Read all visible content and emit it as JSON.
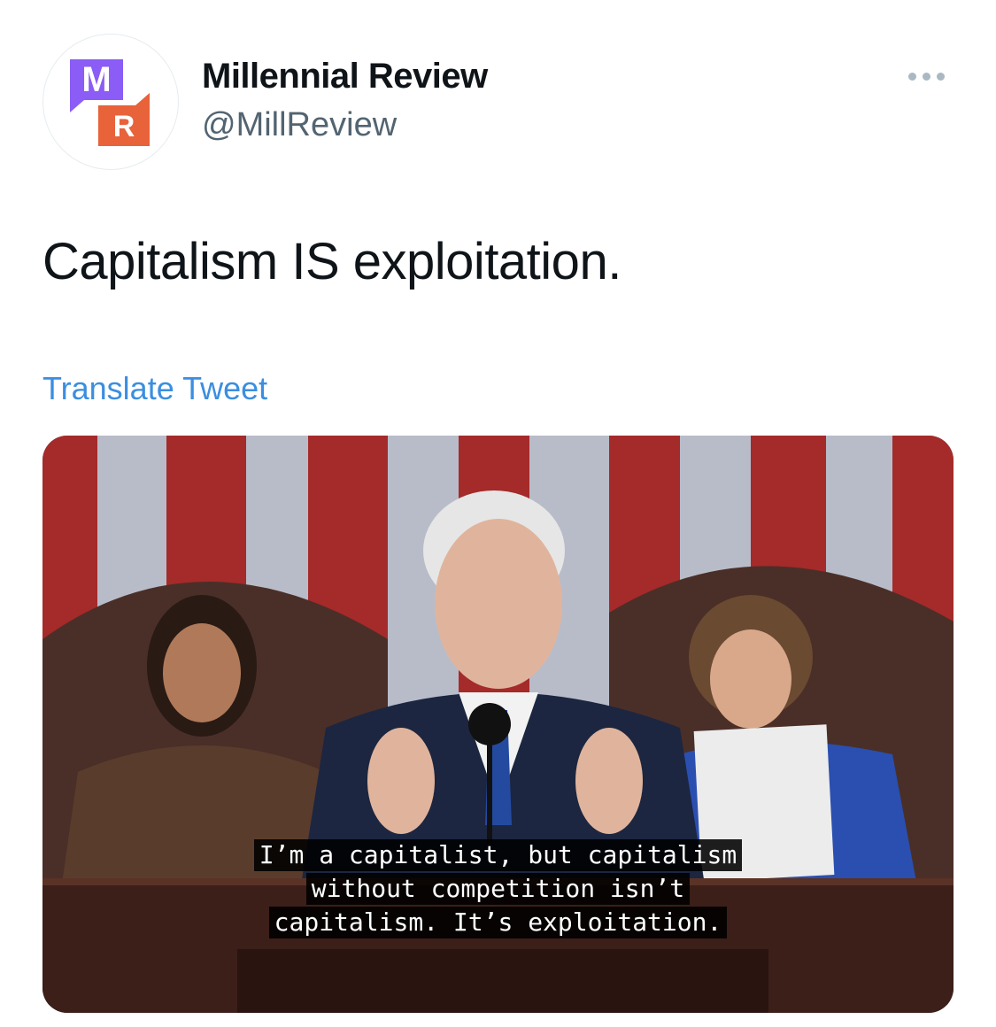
{
  "author": {
    "display_name": "Millennial Review",
    "handle": "@MillReview",
    "avatar": {
      "letter_top": "M",
      "letter_bottom": "R",
      "color_top": "#8b5cf6",
      "color_bottom": "#e8623a"
    }
  },
  "tweet": {
    "text": "Capitalism IS exploitation.",
    "translate_label": "Translate Tweet",
    "more_icon": "more-horizontal-icon"
  },
  "media": {
    "captions": [
      "I’m a capitalist, but capitalism",
      "without competition isn’t",
      "capitalism. It’s exploitation."
    ]
  },
  "colors": {
    "link": "#3b8ee0",
    "text": "#0f1419",
    "secondary": "#536471"
  }
}
